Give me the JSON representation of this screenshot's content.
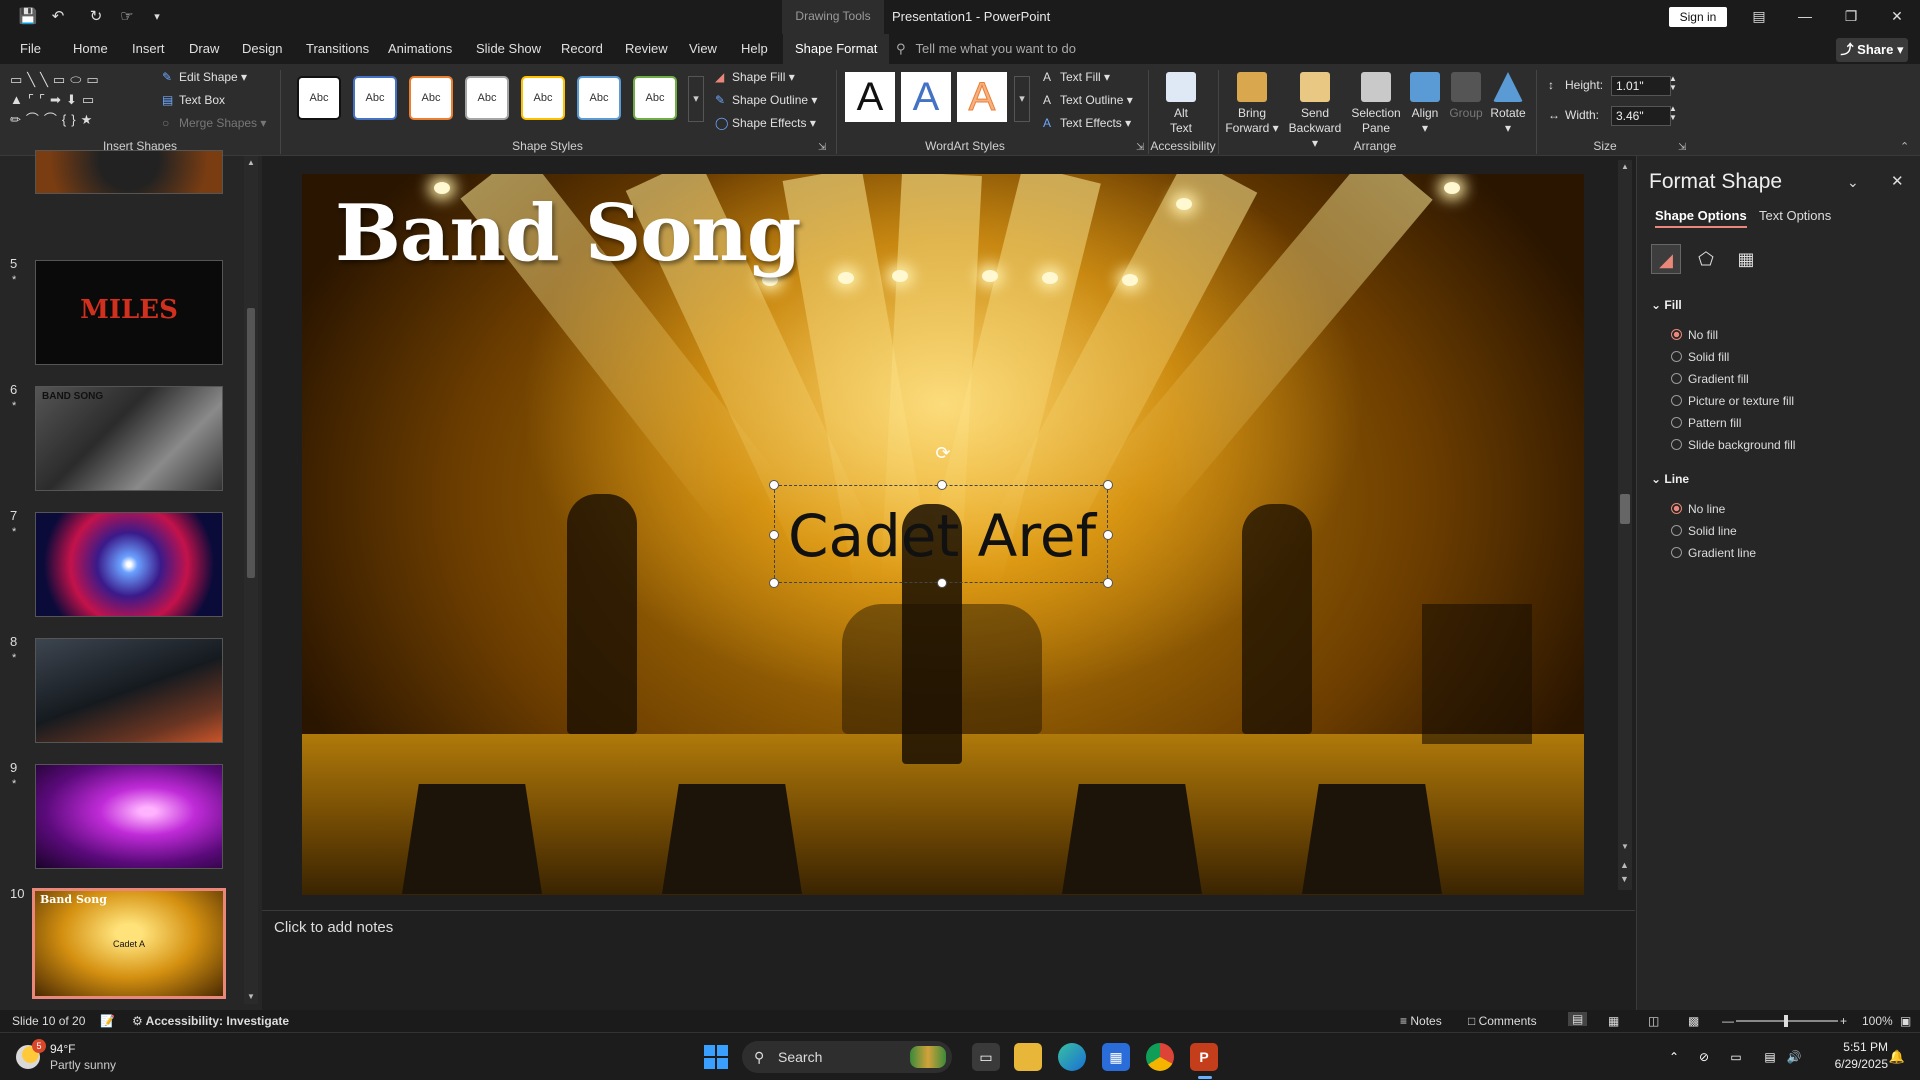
{
  "titlebar": {
    "context_group": "Drawing Tools",
    "doc_title": "Presentation1  -  PowerPoint",
    "sign_in": "Sign in",
    "qat": [
      "save-icon",
      "undo-icon",
      "redo-icon",
      "touch-mode-icon",
      "customize-icon"
    ]
  },
  "tabs": {
    "items": [
      "File",
      "Home",
      "Insert",
      "Draw",
      "Design",
      "Transitions",
      "Animations",
      "Slide Show",
      "Record",
      "Review",
      "View",
      "Help",
      "Shape Format"
    ],
    "active": "Shape Format",
    "tell_me": "Tell me what you want to do",
    "share": "Share"
  },
  "ribbon": {
    "insert_shapes": {
      "label": "Insert Shapes",
      "edit_shape": "Edit Shape",
      "text_box": "Text Box",
      "merge_shapes": "Merge Shapes"
    },
    "shape_styles": {
      "label": "Shape Styles",
      "sample": "Abc",
      "fill": "Shape Fill",
      "outline": "Shape Outline",
      "effects": "Shape Effects",
      "style_colors": [
        "#111111",
        "#4472c4",
        "#ed7d31",
        "#a5a5a5",
        "#ffc000",
        "#5b9bd5",
        "#70ad47"
      ]
    },
    "wordart": {
      "label": "WordArt Styles",
      "letter": "A",
      "text_fill": "Text Fill",
      "text_outline": "Text Outline",
      "text_effects": "Text Effects"
    },
    "accessibility": {
      "label": "Accessibility",
      "alt_text_1": "Alt",
      "alt_text_2": "Text"
    },
    "arrange": {
      "label": "Arrange",
      "bring_forward_1": "Bring",
      "bring_forward_2": "Forward",
      "send_backward_1": "Send",
      "send_backward_2": "Backward",
      "selection_pane_1": "Selection",
      "selection_pane_2": "Pane",
      "align": "Align",
      "group": "Group",
      "rotate": "Rotate"
    },
    "size": {
      "label": "Size",
      "height_label": "Height:",
      "height": "1.01\"",
      "width_label": "Width:",
      "width": "3.46\""
    }
  },
  "thumbnails": {
    "slides": [
      {
        "num": "",
        "star": "",
        "kind": "vinyl"
      },
      {
        "num": "5",
        "star": "*",
        "kind": "miles",
        "text": "MILES"
      },
      {
        "num": "6",
        "star": "*",
        "kind": "drums",
        "text": "BAND SONG"
      },
      {
        "num": "7",
        "star": "*",
        "kind": "tunnel"
      },
      {
        "num": "8",
        "star": "*",
        "kind": "drumkit"
      },
      {
        "num": "9",
        "star": "*",
        "kind": "concert"
      },
      {
        "num": "10",
        "star": "",
        "kind": "stage",
        "title": "Band Song",
        "sub": "Cadet A"
      }
    ]
  },
  "slide": {
    "title": "Band Song",
    "selected_text": "Cadet Aref"
  },
  "notes": {
    "placeholder": "Click to add notes"
  },
  "format_pane": {
    "title": "Format Shape",
    "tabs": [
      "Shape Options",
      "Text Options"
    ],
    "fill_header": "Fill",
    "fill_options": [
      "No fill",
      "Solid fill",
      "Gradient fill",
      "Picture or texture fill",
      "Pattern fill",
      "Slide background fill"
    ],
    "fill_selected": "No fill",
    "line_header": "Line",
    "line_options": [
      "No line",
      "Solid line",
      "Gradient line"
    ],
    "line_selected": "No line"
  },
  "status": {
    "slide_pos": "Slide 10 of 20",
    "accessibility": "Accessibility: Investigate",
    "notes": "Notes",
    "comments": "Comments",
    "zoom": "100%"
  },
  "taskbar": {
    "weather_temp": "94°F",
    "weather_desc": "Partly sunny",
    "weather_badge": "5",
    "search": "Search",
    "time": "5:51 PM",
    "date": "6/29/2025"
  }
}
